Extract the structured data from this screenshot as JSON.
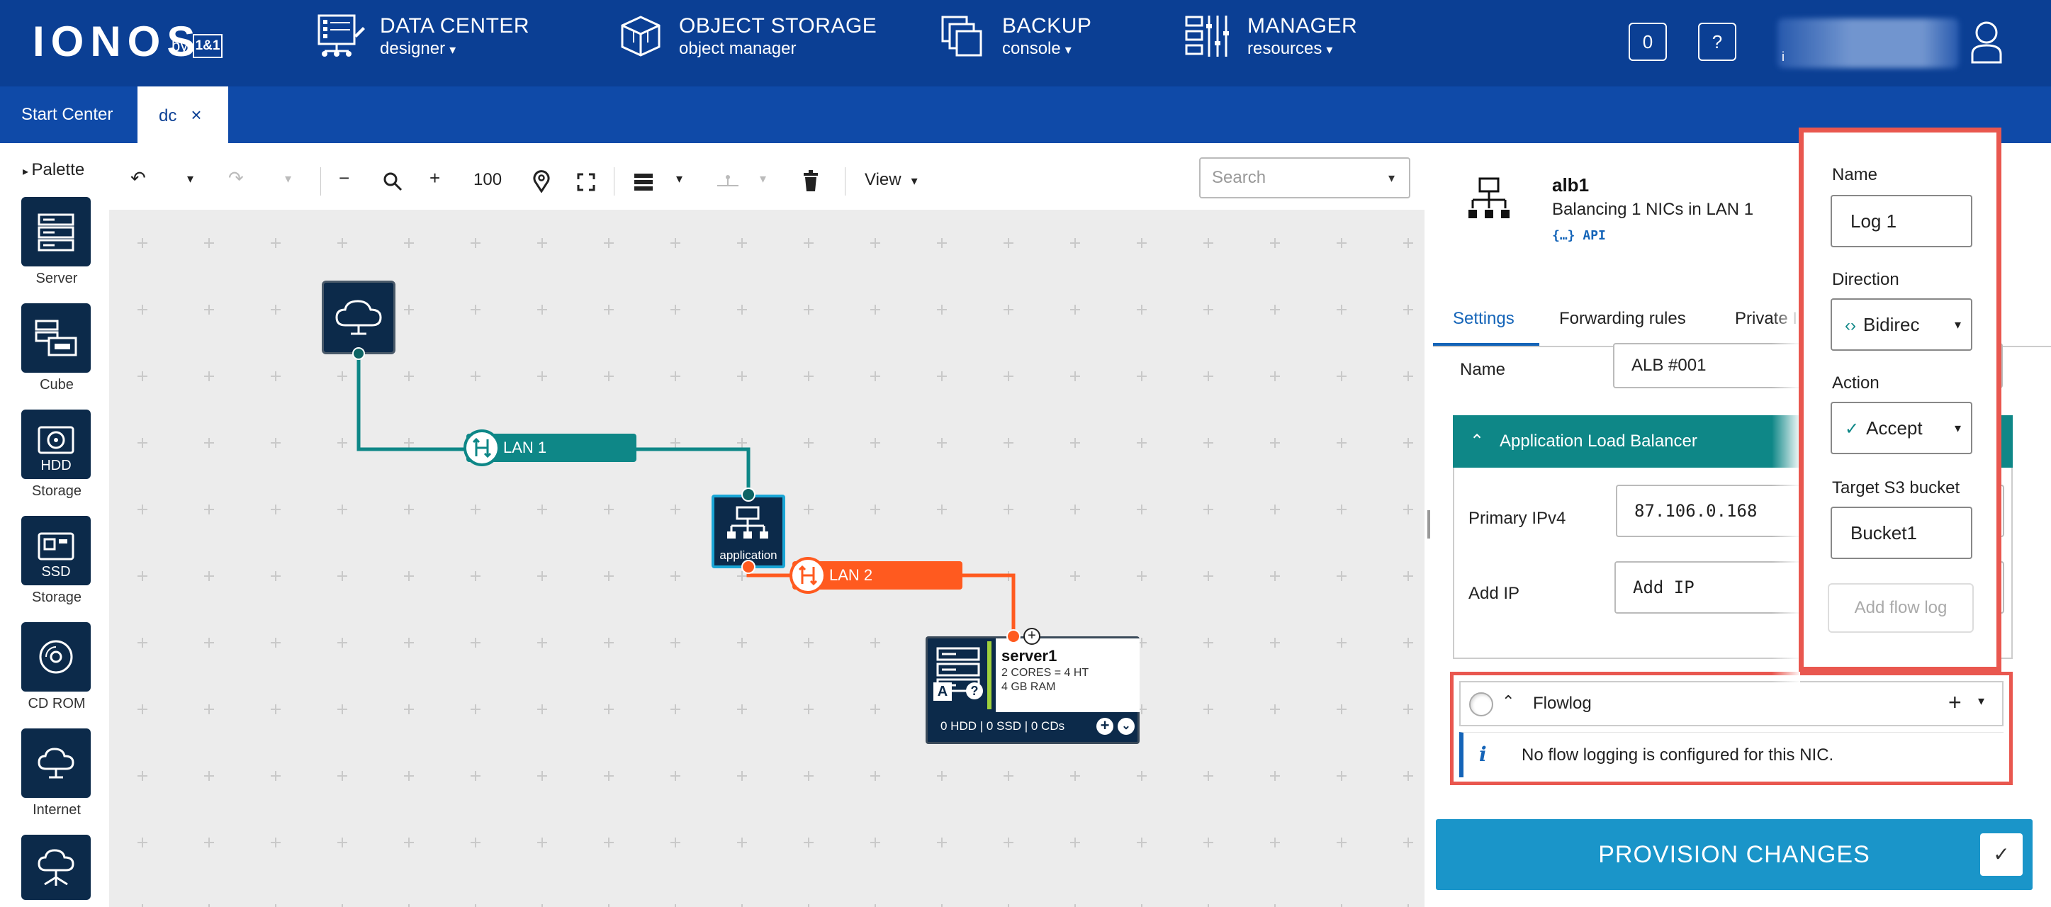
{
  "header": {
    "logo": "IONOS",
    "logo_by": "by",
    "logo_mark": "1&1",
    "nav": [
      {
        "title": "DATA CENTER",
        "sub": "designer"
      },
      {
        "title": "OBJECT STORAGE",
        "sub": "object manager"
      },
      {
        "title": "BACKUP",
        "sub": "console"
      },
      {
        "title": "MANAGER",
        "sub": "resources"
      }
    ],
    "counter": "0",
    "help": "?",
    "user_initial": "i"
  },
  "tabs": [
    {
      "label": "Start Center"
    },
    {
      "label": "dc"
    }
  ],
  "palette": {
    "title": "Palette",
    "items": [
      {
        "label": "Server",
        "icon": "server-icon"
      },
      {
        "label": "Cube",
        "icon": "cube-icon"
      },
      {
        "label": "HDD Storage",
        "line1": "HDD",
        "line2": "Storage",
        "icon": "hdd-icon"
      },
      {
        "label": "SSD Storage",
        "line1": "SSD",
        "line2": "Storage",
        "icon": "ssd-icon"
      },
      {
        "label": "CD ROM",
        "icon": "cdrom-icon"
      },
      {
        "label": "Internet",
        "icon": "internet-icon"
      },
      {
        "label": "",
        "icon": "cloud-network-icon"
      }
    ]
  },
  "toolbar": {
    "zoom": "100",
    "view_label": "View",
    "search_placeholder": "Search"
  },
  "canvas": {
    "lan1": "LAN 1",
    "lan2": "LAN 2",
    "application_label": "application",
    "server": {
      "name": "server1",
      "cores": "2 CORES = 4 HT",
      "ram": "4 GB RAM",
      "storage": "0 HDD | 0 SSD | 0 CDs",
      "badge_a": "A",
      "badge_q": "?"
    }
  },
  "panel": {
    "title": "alb1",
    "subtitle": "Balancing 1 NICs in LAN 1",
    "api": "{…} API",
    "tabs": [
      "Settings",
      "Forwarding rules",
      "Private I"
    ],
    "name_label": "Name",
    "name_value": "ALB #001",
    "section_title": "Application Load Balancer",
    "primary_ipv4_label": "Primary IPv4",
    "primary_ipv4_value": "87.106.0.168",
    "add_ip_label": "Add IP",
    "add_ip_placeholder": "Add IP",
    "flowlog_title": "Flowlog",
    "flowlog_info": "No flow logging is configured for this NIC.",
    "info_glyph": "i",
    "provision_label": "PROVISION CHANGES"
  },
  "flowlog_form": {
    "name_label": "Name",
    "name_value": "Log 1",
    "direction_label": "Direction",
    "direction_value": "Bidirec",
    "action_label": "Action",
    "action_value": "Accept",
    "bucket_label": "Target S3 bucket",
    "bucket_value": "Bucket1",
    "add_button": "Add flow log"
  },
  "colors": {
    "header": "#0b3f94",
    "accent_teal": "#0e8787",
    "lan2_orange": "#ff5a1f",
    "highlight_red": "#e9574f",
    "provision_blue": "#1a95c9"
  }
}
